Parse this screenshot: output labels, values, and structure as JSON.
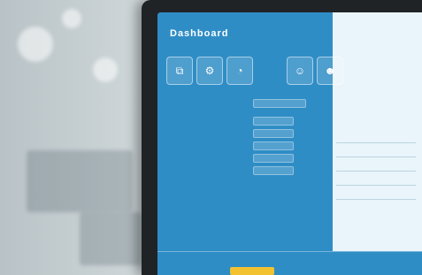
{
  "scene": {
    "type": "photo-of-monitor",
    "accent_colors": {
      "screen_blue": "#2f8dc6",
      "screen_light": "#e9f5fb",
      "badge_yellow": "#f2c230"
    }
  },
  "dashboard": {
    "title": "Dashboard",
    "toolbar_icons": [
      {
        "name": "link-icon",
        "glyph": "⧉"
      },
      {
        "name": "settings-icon",
        "glyph": "⚙"
      },
      {
        "name": "gauge-icon",
        "glyph": "◔"
      },
      {
        "name": "profile-icon-1",
        "glyph": "☺"
      },
      {
        "name": "profile-icon-2",
        "glyph": "☻"
      }
    ]
  }
}
